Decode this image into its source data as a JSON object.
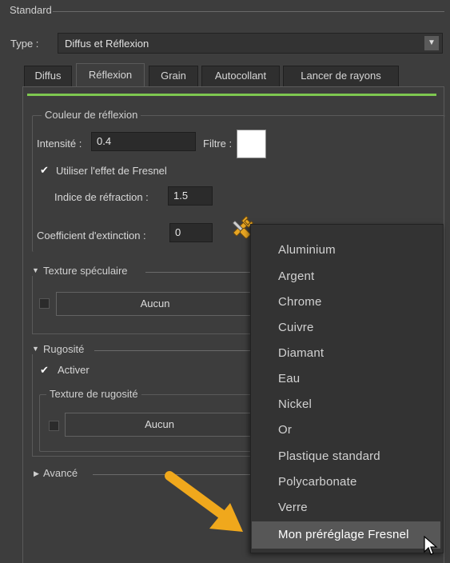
{
  "panel": {
    "title": "Standard"
  },
  "type_row": {
    "label": "Type :",
    "value": "Diffus et Réflexion"
  },
  "tabs": [
    {
      "label": "Diffus",
      "active": false
    },
    {
      "label": "Réflexion",
      "active": true
    },
    {
      "label": "Grain",
      "active": false
    },
    {
      "label": "Autocollant",
      "active": false
    },
    {
      "label": "Lancer de rayons",
      "active": false
    }
  ],
  "accent_color": "#7ec850",
  "reflection": {
    "group_title": "Couleur de réflexion",
    "intensity_label": "Intensité :",
    "intensity_value": "0.4",
    "filter_label": "Filtre :",
    "filter_color": "#ffffff",
    "fresnel_label": "Utiliser l'effet de Fresnel",
    "fresnel_checked": true,
    "refraction_label": "Indice de réfraction :",
    "refraction_value": "1.5",
    "extinction_label": "Coefficient d'extinction :",
    "extinction_value": "0"
  },
  "specular": {
    "title": "Texture spéculaire",
    "button": "Aucun"
  },
  "roughness": {
    "title": "Rugosité",
    "activate_label": "Activer",
    "activate_checked": true,
    "texture_title": "Texture de rugosité",
    "button": "Aucun"
  },
  "advanced": {
    "title": "Avancé"
  },
  "preset_menu": {
    "items": [
      "Aluminium",
      "Argent",
      "Chrome",
      "Cuivre",
      "Diamant",
      "Eau",
      "Nickel",
      "Or",
      "Plastique standard",
      "Polycarbonate",
      "Verre",
      "Mon préréglage Fresnel"
    ],
    "highlighted_index": 11
  }
}
